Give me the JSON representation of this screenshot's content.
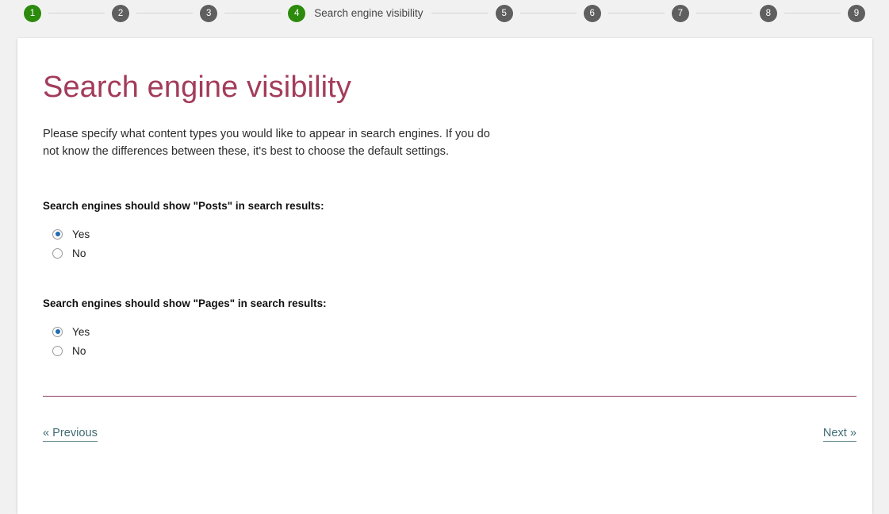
{
  "stepbar": {
    "steps": [
      {
        "number": "1",
        "label": "",
        "state": "inactive"
      },
      {
        "number": "2",
        "label": "",
        "state": "inactive"
      },
      {
        "number": "3",
        "label": "",
        "state": "inactive"
      },
      {
        "number": "4",
        "label": "Search engine visibility",
        "state": "active"
      },
      {
        "number": "5",
        "label": "",
        "state": "inactive"
      },
      {
        "number": "6",
        "label": "",
        "state": "inactive"
      },
      {
        "number": "7",
        "label": "",
        "state": "inactive"
      },
      {
        "number": "8",
        "label": "",
        "state": "inactive"
      },
      {
        "number": "9",
        "label": "",
        "state": "inactive"
      }
    ],
    "active_color": "#2c8a0d",
    "inactive_color": "#5f5f5f"
  },
  "page": {
    "title": "Search engine visibility",
    "title_color": "#a33c5b",
    "intro": "Please specify what content types you would like to appear in search engines. If you do not know the differences between these, it's best to choose the default settings.",
    "divider_color": "#8e3a5e"
  },
  "questions": [
    {
      "label": "Search engines should show \"Posts\" in search results:",
      "options": [
        {
          "label": "Yes",
          "selected": true
        },
        {
          "label": "No",
          "selected": false
        }
      ]
    },
    {
      "label": "Search engines should show \"Pages\" in search results:",
      "options": [
        {
          "label": "Yes",
          "selected": true
        },
        {
          "label": "No",
          "selected": false
        }
      ]
    }
  ],
  "nav": {
    "previous": "« Previous",
    "next": "Next »",
    "link_color": "#3f6b74"
  }
}
